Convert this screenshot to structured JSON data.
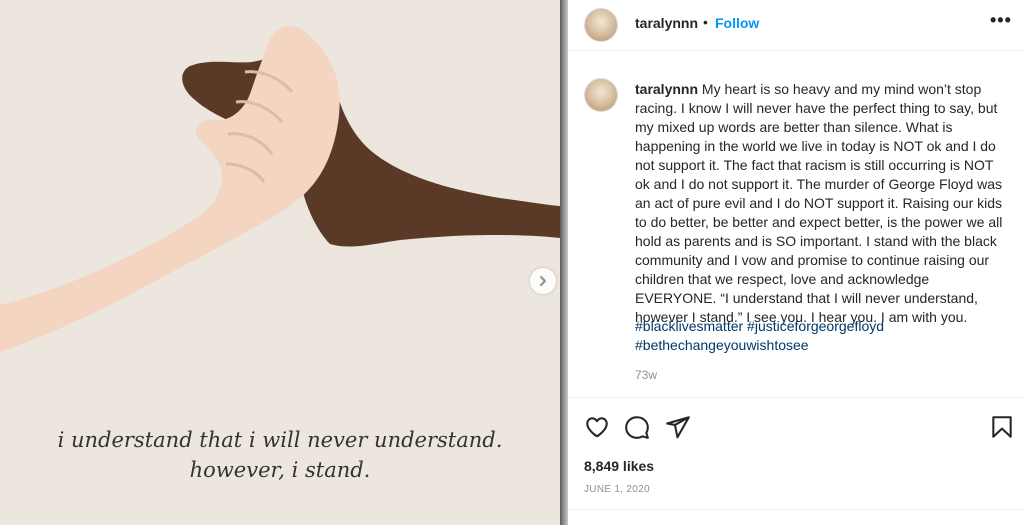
{
  "post": {
    "username": "taralynnn",
    "separator": "•",
    "follow_label": "Follow",
    "more_label": "•••",
    "image_text": {
      "line1": "i understand that i will never understand.",
      "line2": "however, i stand."
    },
    "caption_username": "taralynnn",
    "caption_text": "My heart is so heavy and my mind won’t stop racing. I know I will never have the perfect thing to say, but my mixed up words are better than silence. What is happening in the world we live in today is NOT ok and I do not support it. The fact that racism is still occurring is NOT ok and I do not support it. The murder of George Floyd was an act of pure evil and I do NOT support it. Raising our kids to do better, be better and expect better, is the power we all hold as parents and is SO important. I stand with the black community and I vow and promise to continue raising our children that we respect, love and acknowledge EVERYONE. “I understand that I will never understand, however I stand.” I see you. I hear you. I am with you.",
    "hashtags": [
      "#blacklivesmatter",
      "#justiceforgeorgefloyd",
      "#bethechangeyouwishtosee"
    ],
    "time_ago": "73w",
    "likes": "8,849 likes",
    "date": "JUNE 1, 2020"
  },
  "icons": {
    "like": "heart-icon",
    "comment": "comment-icon",
    "share": "paper-plane-icon",
    "save": "bookmark-icon",
    "carousel_next": "chevron-right-icon",
    "more": "more-options-icon"
  }
}
